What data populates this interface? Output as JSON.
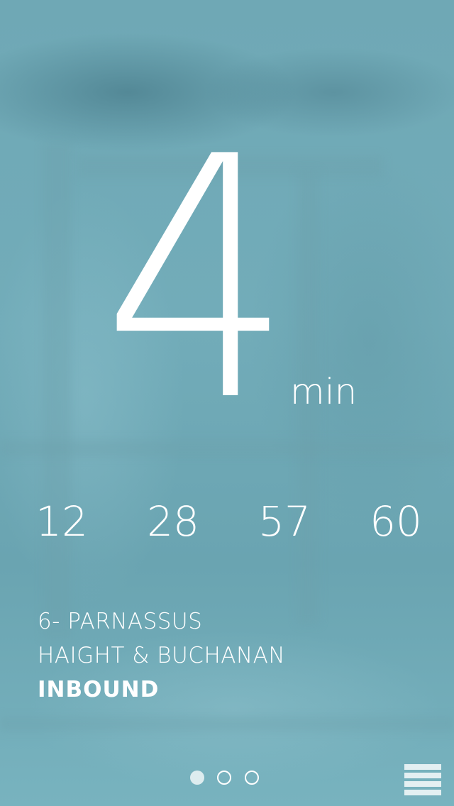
{
  "next_arrival": {
    "value": "4",
    "unit": "min"
  },
  "upcoming_arrivals": [
    "12",
    "28",
    "57",
    "60"
  ],
  "route": {
    "name": "6- PARNASSUS",
    "stop": "HAIGHT & BUCHANAN",
    "direction": "INBOUND"
  },
  "pager": {
    "page_count": 3,
    "current_page": 1
  },
  "colors": {
    "background": "#6ea9b6",
    "text": "#ffffff"
  },
  "icons": {
    "menu": "hamburger-menu-icon"
  }
}
